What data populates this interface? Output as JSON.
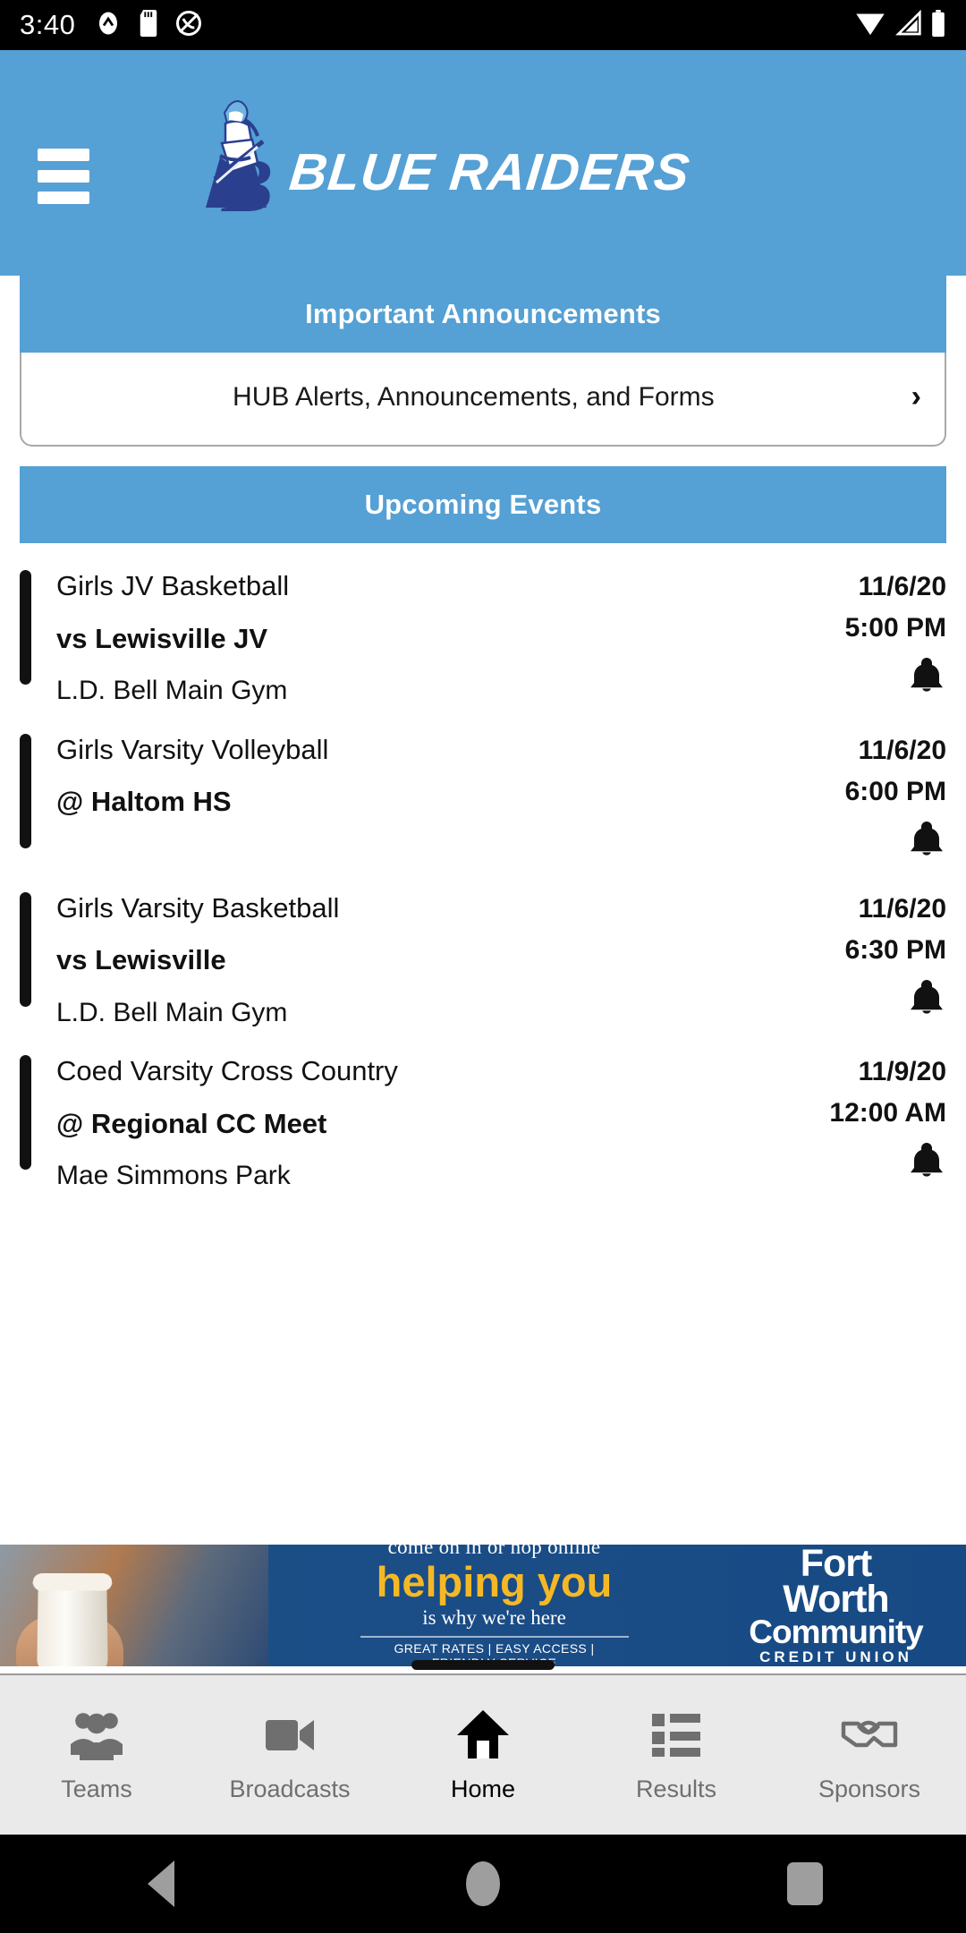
{
  "status_bar": {
    "time": "3:40",
    "left_icons": [
      "chevron-badge-icon",
      "sd-card-icon",
      "do-not-disturb-icon"
    ],
    "right_icons": [
      "wifi-icon",
      "cell-signal-icon",
      "battery-icon"
    ]
  },
  "header": {
    "menu_icon": "hamburger-menu-icon",
    "logo_icon": "blue-raiders-knight-logo",
    "brand_text": "BLUE RAIDERS"
  },
  "announcements": {
    "title": "Important Announcements",
    "row_label": "HUB Alerts, Announcements, and Forms",
    "chevron": "›"
  },
  "upcoming": {
    "title": "Upcoming Events",
    "events": [
      {
        "sport": "Girls JV Basketball",
        "opponent": "vs Lewisville JV",
        "venue": "L.D. Bell Main Gym",
        "date": "11/6/20",
        "time": "5:00 PM",
        "alert_icon": "bell-icon"
      },
      {
        "sport": "Girls Varsity Volleyball",
        "opponent": "@ Haltom HS",
        "venue": "",
        "date": "11/6/20",
        "time": "6:00 PM",
        "alert_icon": "bell-icon"
      },
      {
        "sport": "Girls Varsity Basketball",
        "opponent": "vs Lewisville",
        "venue": "L.D. Bell Main Gym",
        "date": "11/6/20",
        "time": "6:30 PM",
        "alert_icon": "bell-icon"
      },
      {
        "sport": "Coed Varsity Cross Country",
        "opponent": "@ Regional CC Meet",
        "venue": "Mae Simmons Park",
        "date": "11/9/20",
        "time": "12:00 AM",
        "alert_icon": "bell-icon"
      }
    ]
  },
  "ad": {
    "line1": "come on in or hop online",
    "line2": "helping you",
    "line3": "is why we're here",
    "line4": "GREAT RATES | EASY ACCESS | FRIENDLY SERVICE",
    "brand_line1": "Fort",
    "brand_line2": "Worth",
    "brand_line3": "Community",
    "brand_line4": "CREDIT UNION"
  },
  "tabbar": {
    "tabs": [
      {
        "label": "Teams",
        "icon": "people-group-icon",
        "active": false
      },
      {
        "label": "Broadcasts",
        "icon": "video-camera-icon",
        "active": false
      },
      {
        "label": "Home",
        "icon": "home-icon",
        "active": true
      },
      {
        "label": "Results",
        "icon": "list-icon",
        "active": false
      },
      {
        "label": "Sponsors",
        "icon": "handshake-icon",
        "active": false
      }
    ]
  },
  "android_nav": {
    "back": "back-triangle-icon",
    "home": "home-circle-icon",
    "recents": "recents-square-icon"
  },
  "colors": {
    "brand_blue": "#55a0d4",
    "logo_navy": "#2b3f8f",
    "ad_blue": "#1d4f86",
    "ad_yellow": "#f5b825",
    "tabbar_bg": "#eaeaea",
    "inactive_gray": "#6f6f6f"
  }
}
